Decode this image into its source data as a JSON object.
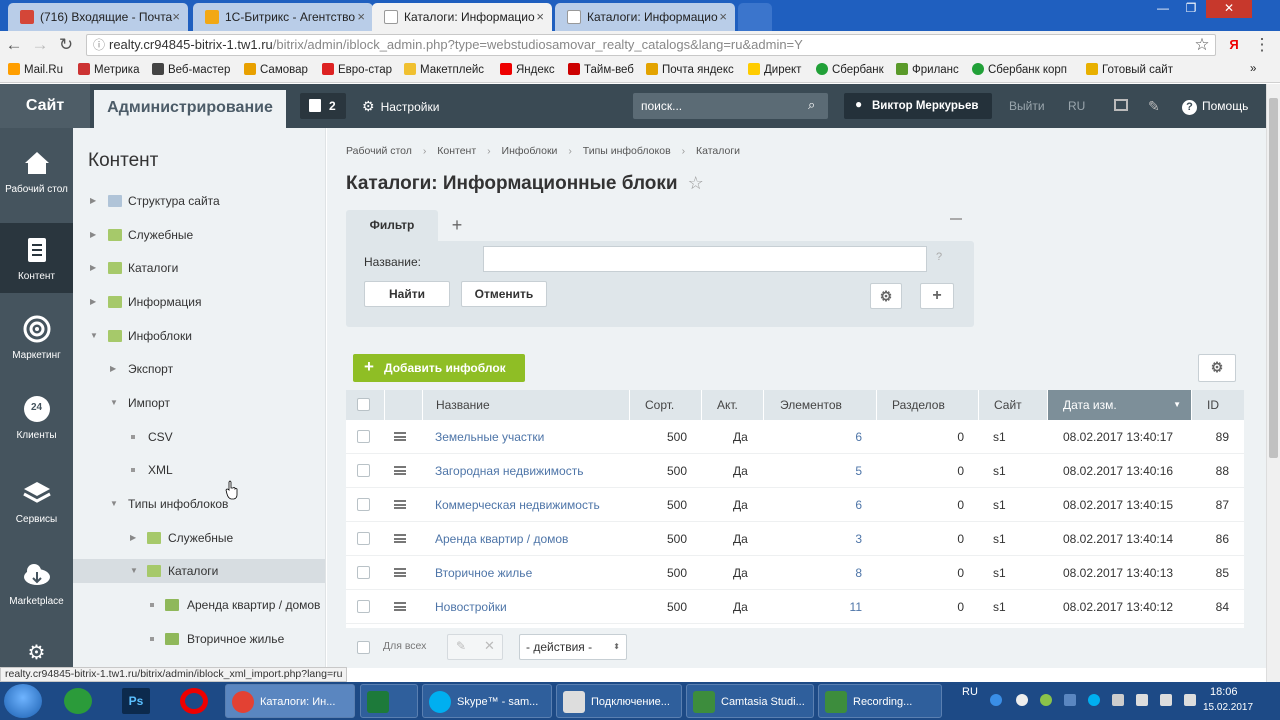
{
  "browser": {
    "tabs": [
      {
        "label": "(716) Входящие - Почта",
        "color": "#d44638"
      },
      {
        "label": "1С-Битрикс - Агентство",
        "color": "#f2a814"
      },
      {
        "label": "Каталоги: Информацио",
        "color": "#e7ebef"
      },
      {
        "label": "Каталоги: Информацио",
        "color": "#e7ebef"
      }
    ],
    "window_controls": [
      "—",
      "❐",
      "✕"
    ],
    "url_host": "realty.cr94845-bitrix-1.tw1.ru",
    "url_path": "/bitrix/admin/iblock_admin.php?type=webstudiosamovar_realty_catalogs&lang=ru&admin=Y",
    "bookmarks": [
      {
        "label": "Mail.Ru",
        "color": "#ff9e00"
      },
      {
        "label": "Метрика",
        "color": "#c33"
      },
      {
        "label": "Веб-мастер",
        "color": "#444"
      },
      {
        "label": "Самовар",
        "color": "#e8a000"
      },
      {
        "label": "Евро-стар",
        "color": "#d22"
      },
      {
        "label": "Макетплейс",
        "color": "#f0c030"
      },
      {
        "label": "Яндекс",
        "color": "#e00"
      },
      {
        "label": "Тайм-веб",
        "color": "#c00"
      },
      {
        "label": "Почта яндекс",
        "color": "#e3a300"
      },
      {
        "label": "Директ",
        "color": "#ffcc00"
      },
      {
        "label": "Сбербанк",
        "color": "#21a038"
      },
      {
        "label": "Фриланс",
        "color": "#5a9a2a"
      },
      {
        "label": "Сбербанк корп",
        "color": "#21a038"
      },
      {
        "label": "Готовый сайт",
        "color": "#e8b000"
      }
    ],
    "bookmarks_more": "»"
  },
  "topbar": {
    "site": "Сайт",
    "admin": "Администрирование",
    "notifications": "2",
    "settings": "Настройки",
    "search_placeholder": "поиск...",
    "user": "Виктор Меркурьев",
    "logout": "Выйти",
    "lang": "RU",
    "help": "Помощь"
  },
  "rail": [
    {
      "label": "Рабочий стол",
      "icon": "home-icon"
    },
    {
      "label": "Контент",
      "icon": "content-icon"
    },
    {
      "label": "Маркетинг",
      "icon": "target-icon"
    },
    {
      "label": "Клиенты",
      "icon": "clients-icon",
      "badge": "24"
    },
    {
      "label": "Сервисы",
      "icon": "layers-icon"
    },
    {
      "label": "Marketplace",
      "icon": "cloud-download-icon"
    }
  ],
  "tree": {
    "title": "Контент",
    "items": [
      {
        "label": "Структура сайта"
      },
      {
        "label": "Служебные"
      },
      {
        "label": "Каталоги"
      },
      {
        "label": "Информация"
      },
      {
        "label": "Инфоблоки"
      },
      {
        "label": "Экспорт"
      },
      {
        "label": "Импорт"
      },
      {
        "label": "CSV"
      },
      {
        "label": "XML"
      },
      {
        "label": "Типы инфоблоков"
      },
      {
        "label": "Служебные"
      },
      {
        "label": "Каталоги"
      },
      {
        "label": "Аренда квартир / домов"
      },
      {
        "label": "Вторичное жилье"
      }
    ]
  },
  "main": {
    "breadcrumb": [
      "Рабочий стол",
      "Контент",
      "Инфоблоки",
      "Типы инфоблоков",
      "Каталоги"
    ],
    "title": "Каталоги: Информационные блоки",
    "filter": {
      "tab": "Фильтр",
      "name_label": "Название:",
      "name_value": "",
      "find": "Найти",
      "cancel": "Отменить"
    },
    "add_button": "Добавить инфоблок",
    "columns": [
      "Название",
      "Сорт.",
      "Акт.",
      "Элементов",
      "Разделов",
      "Сайт",
      "Дата изм.",
      "ID"
    ],
    "rows": [
      {
        "name": "Земельные участки",
        "sort": "500",
        "active": "Да",
        "elements": "6",
        "sections": "0",
        "site": "s1",
        "date": "08.02.2017 13:40:17",
        "id": "89"
      },
      {
        "name": "Загородная недвижимость",
        "sort": "500",
        "active": "Да",
        "elements": "5",
        "sections": "0",
        "site": "s1",
        "date": "08.02.2017 13:40:16",
        "id": "88"
      },
      {
        "name": "Коммерческая недвижимость",
        "sort": "500",
        "active": "Да",
        "elements": "6",
        "sections": "0",
        "site": "s1",
        "date": "08.02.2017 13:40:15",
        "id": "87"
      },
      {
        "name": "Аренда квартир / домов",
        "sort": "500",
        "active": "Да",
        "elements": "3",
        "sections": "0",
        "site": "s1",
        "date": "08.02.2017 13:40:14",
        "id": "86"
      },
      {
        "name": "Вторичное жилье",
        "sort": "500",
        "active": "Да",
        "elements": "8",
        "sections": "0",
        "site": "s1",
        "date": "08.02.2017 13:40:13",
        "id": "85"
      },
      {
        "name": "Новостройки",
        "sort": "500",
        "active": "Да",
        "elements": "11",
        "sections": "0",
        "site": "s1",
        "date": "08.02.2017 13:40:12",
        "id": "84"
      }
    ],
    "for_all": "Для всех",
    "actions": "- действия -"
  },
  "status_url": "realty.cr94845-bitrix-1.tw1.ru/bitrix/admin/iblock_xml_import.php?lang=ru",
  "taskbar": {
    "windows": [
      {
        "label": "Каталоги: Ин...",
        "color": "#e34133"
      },
      {
        "label": "",
        "color": "#1d7a3a"
      },
      {
        "label": "Skype™ - sam...",
        "color": "#00aff0"
      },
      {
        "label": "Подключение...",
        "color": "#ddd"
      },
      {
        "label": "Camtasia Studi...",
        "color": "#3d8d3d"
      },
      {
        "label": "Recording...",
        "color": "#3d8d3d"
      }
    ],
    "lang": "RU",
    "time": "18:06",
    "date": "15.02.2017"
  }
}
